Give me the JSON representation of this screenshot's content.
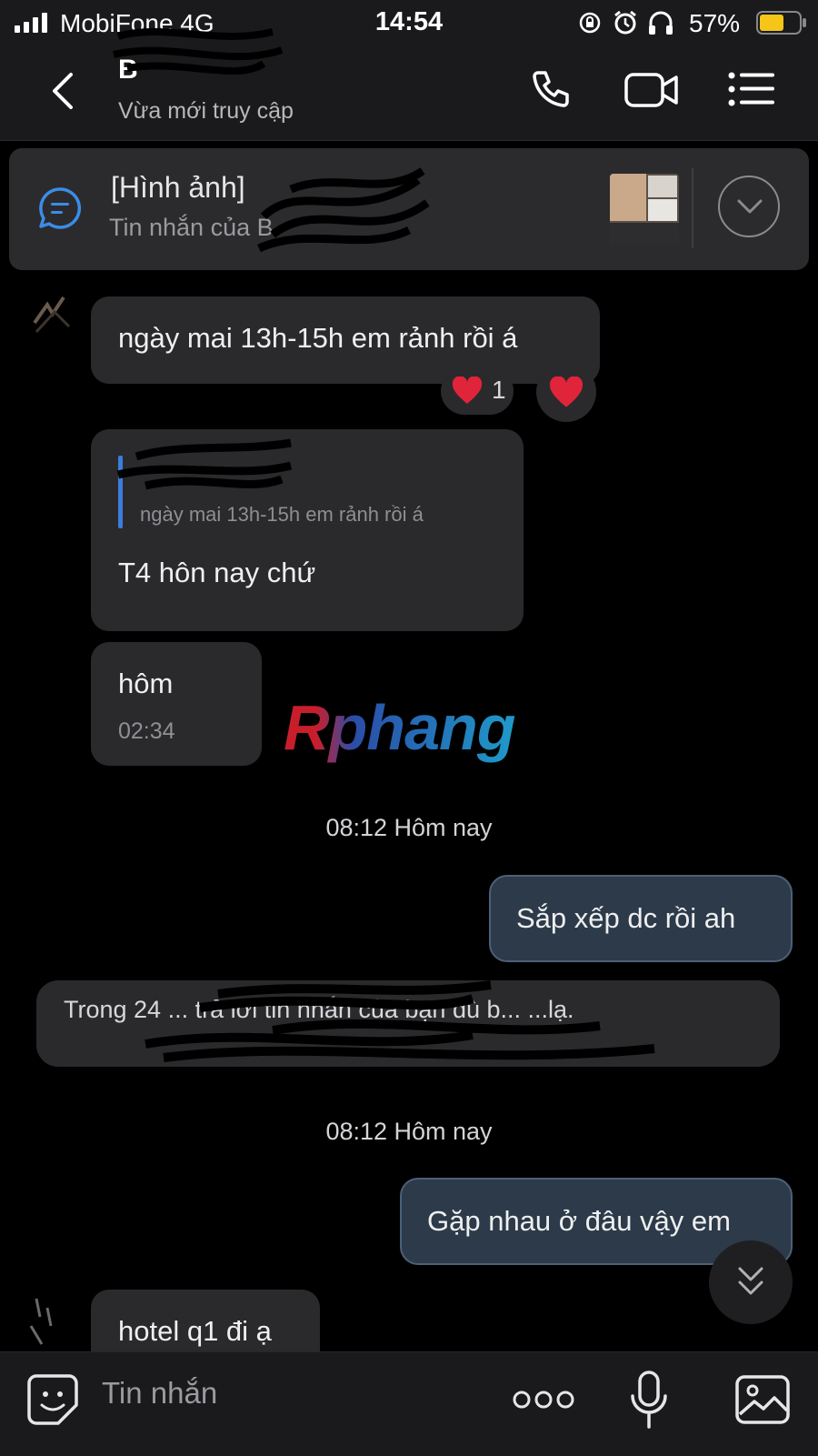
{
  "status_bar": {
    "carrier": "MobiFone 4G",
    "time": "14:54",
    "battery_percent": "57%"
  },
  "header": {
    "contact_name": "B",
    "subtitle": "Vừa mới truy cập"
  },
  "pinned": {
    "title": "[Hình ảnh]",
    "subtitle": "Tin nhắn của B"
  },
  "messages": {
    "m1_text": "ngày mai 13h-15h em rảnh rồi á",
    "m1_reaction_count": "1",
    "m2_quote_text": "ngày mai 13h-15h em rảnh rồi á",
    "m2_text": "T4 hôn nay chứ",
    "m3_text": "hôm",
    "m3_time": "02:34",
    "timestamp1": "08:12 Hôm nay",
    "m4_text": "Sắp xếp dc rồi ah",
    "system_text": "Trong 24 ... trả lời tin nhắn của bạn dù b... ...lạ.",
    "timestamp2": "08:12 Hôm nay",
    "m5_text": "Gặp nhau ở đâu vậy em",
    "m6_text": "hotel q1 đi ạ"
  },
  "watermark": "Rphang",
  "composer": {
    "placeholder": "Tin nhắn"
  },
  "colors": {
    "background": "#000000",
    "bubble_in": "#2a2a2d",
    "bubble_out": "#2c3a4a",
    "accent_blue": "#3b7ddd",
    "heart": "#e0243a",
    "battery": "#f5c518"
  },
  "icons": [
    "signal-icon",
    "lock-rotation-icon",
    "alarm-icon",
    "headphones-icon",
    "battery-icon",
    "back-icon",
    "phone-icon",
    "video-call-icon",
    "menu-icon",
    "chat-bubble-icon",
    "chevron-down-icon",
    "heart-icon",
    "double-chevron-down-icon",
    "sticker-icon",
    "more-icon",
    "microphone-icon",
    "image-icon"
  ]
}
